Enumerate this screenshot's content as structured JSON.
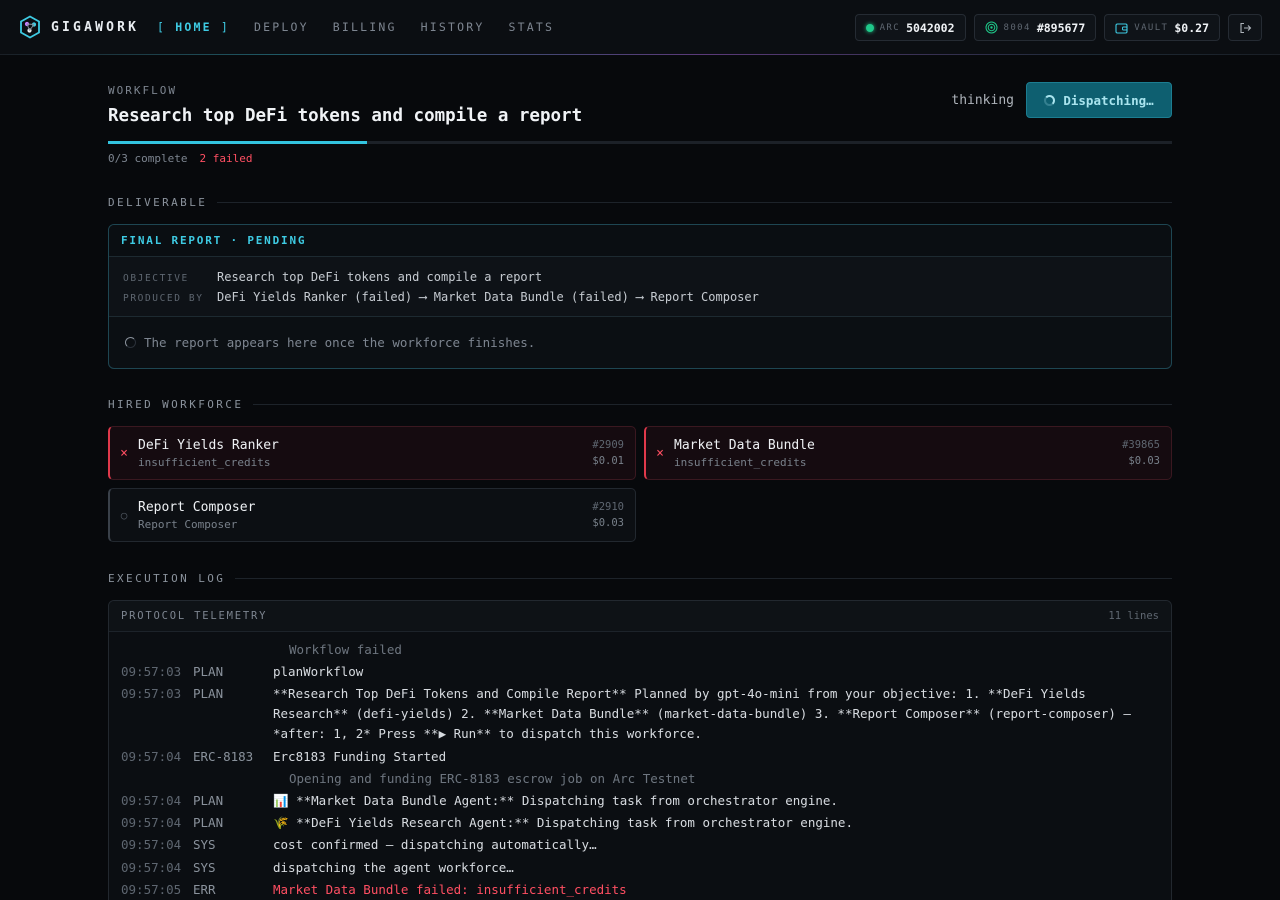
{
  "app": {
    "name": "GIGAWORK"
  },
  "nav": {
    "bracket_open": "[",
    "bracket_close": "]",
    "items": [
      {
        "label": "HOME",
        "active": true
      },
      {
        "label": "DEPLOY",
        "active": false
      },
      {
        "label": "BILLING",
        "active": false
      },
      {
        "label": "HISTORY",
        "active": false
      },
      {
        "label": "STATS",
        "active": false
      }
    ]
  },
  "status": {
    "arc": {
      "label": "ARC",
      "value": "5042002"
    },
    "agent": {
      "label": "8004",
      "value": "#895677"
    },
    "vault": {
      "label": "VAULT",
      "value": "$0.27"
    }
  },
  "workflow": {
    "label": "WORKFLOW",
    "title": "Research top DeFi tokens and compile a report",
    "state": "thinking",
    "dispatch_label": "Dispatching…",
    "progress_fraction": 0.243,
    "complete_text": "0/3 complete",
    "failed_text": "2 failed"
  },
  "deliverable": {
    "section_title": "DELIVERABLE",
    "header": "FINAL REPORT · PENDING",
    "objective_key": "OBJECTIVE",
    "objective_val": "Research top DeFi tokens and compile a report",
    "produced_key": "PRODUCED BY",
    "produced_val": "DeFi Yields Ranker (failed) ⟶ Market Data Bundle (failed) ⟶ Report Composer",
    "pending_text": "The report appears here once the workforce finishes."
  },
  "workforce": {
    "section_title": "HIRED WORKFORCE",
    "agents": [
      {
        "name": "DeFi Yields Ranker",
        "sub": "insufficient_credits",
        "id": "#2909",
        "price": "$0.01",
        "status": "failed",
        "icon": "x-icon",
        "glyph": "×"
      },
      {
        "name": "Market Data Bundle",
        "sub": "insufficient_credits",
        "id": "#39865",
        "price": "$0.03",
        "status": "failed",
        "icon": "x-icon",
        "glyph": "×"
      },
      {
        "name": "Report Composer",
        "sub": "Report Composer",
        "id": "#2910",
        "price": "$0.03",
        "status": "pending",
        "icon": "circle-icon",
        "glyph": "○"
      }
    ]
  },
  "log": {
    "section_title": "EXECUTION LOG",
    "title": "PROTOCOL TELEMETRY",
    "count": "11 lines",
    "entries": [
      {
        "kind": "note",
        "msg": "Workflow failed"
      },
      {
        "kind": "line",
        "time": "09:57:03",
        "tag": "PLAN",
        "msg": "planWorkflow"
      },
      {
        "kind": "line",
        "time": "09:57:03",
        "tag": "PLAN",
        "msg": "**Research Top DeFi Tokens and Compile Report** Planned by gpt-4o-mini from your objective: 1. **DeFi Yields Research** (defi-yields) 2. **Market Data Bundle** (market-data-bundle) 3. **Report Composer** (report-composer) — *after: 1, 2* Press **▶ Run** to dispatch this workforce."
      },
      {
        "kind": "line",
        "time": "09:57:04",
        "tag": "ERC-8183",
        "msg": "Erc8183 Funding Started"
      },
      {
        "kind": "note",
        "msg": "Opening and funding ERC-8183 escrow job on Arc Testnet"
      },
      {
        "kind": "line",
        "time": "09:57:04",
        "tag": "PLAN",
        "msg": "📊 **Market Data Bundle Agent:** Dispatching task from orchestrator engine."
      },
      {
        "kind": "line",
        "time": "09:57:04",
        "tag": "PLAN",
        "msg": "🌾 **DeFi Yields Research Agent:** Dispatching task from orchestrator engine."
      },
      {
        "kind": "line",
        "time": "09:57:04",
        "tag": "SYS",
        "msg": "cost confirmed — dispatching automatically…"
      },
      {
        "kind": "line",
        "time": "09:57:04",
        "tag": "SYS",
        "msg": "dispatching the agent workforce…"
      },
      {
        "kind": "err",
        "time": "09:57:05",
        "tag": "ERR",
        "msg": "Market Data Bundle failed: insufficient_credits"
      }
    ]
  },
  "colors": {
    "accent": "#3ecbe3",
    "danger": "#ff4f62",
    "ok": "#1fc98a",
    "background": "#07090c"
  }
}
